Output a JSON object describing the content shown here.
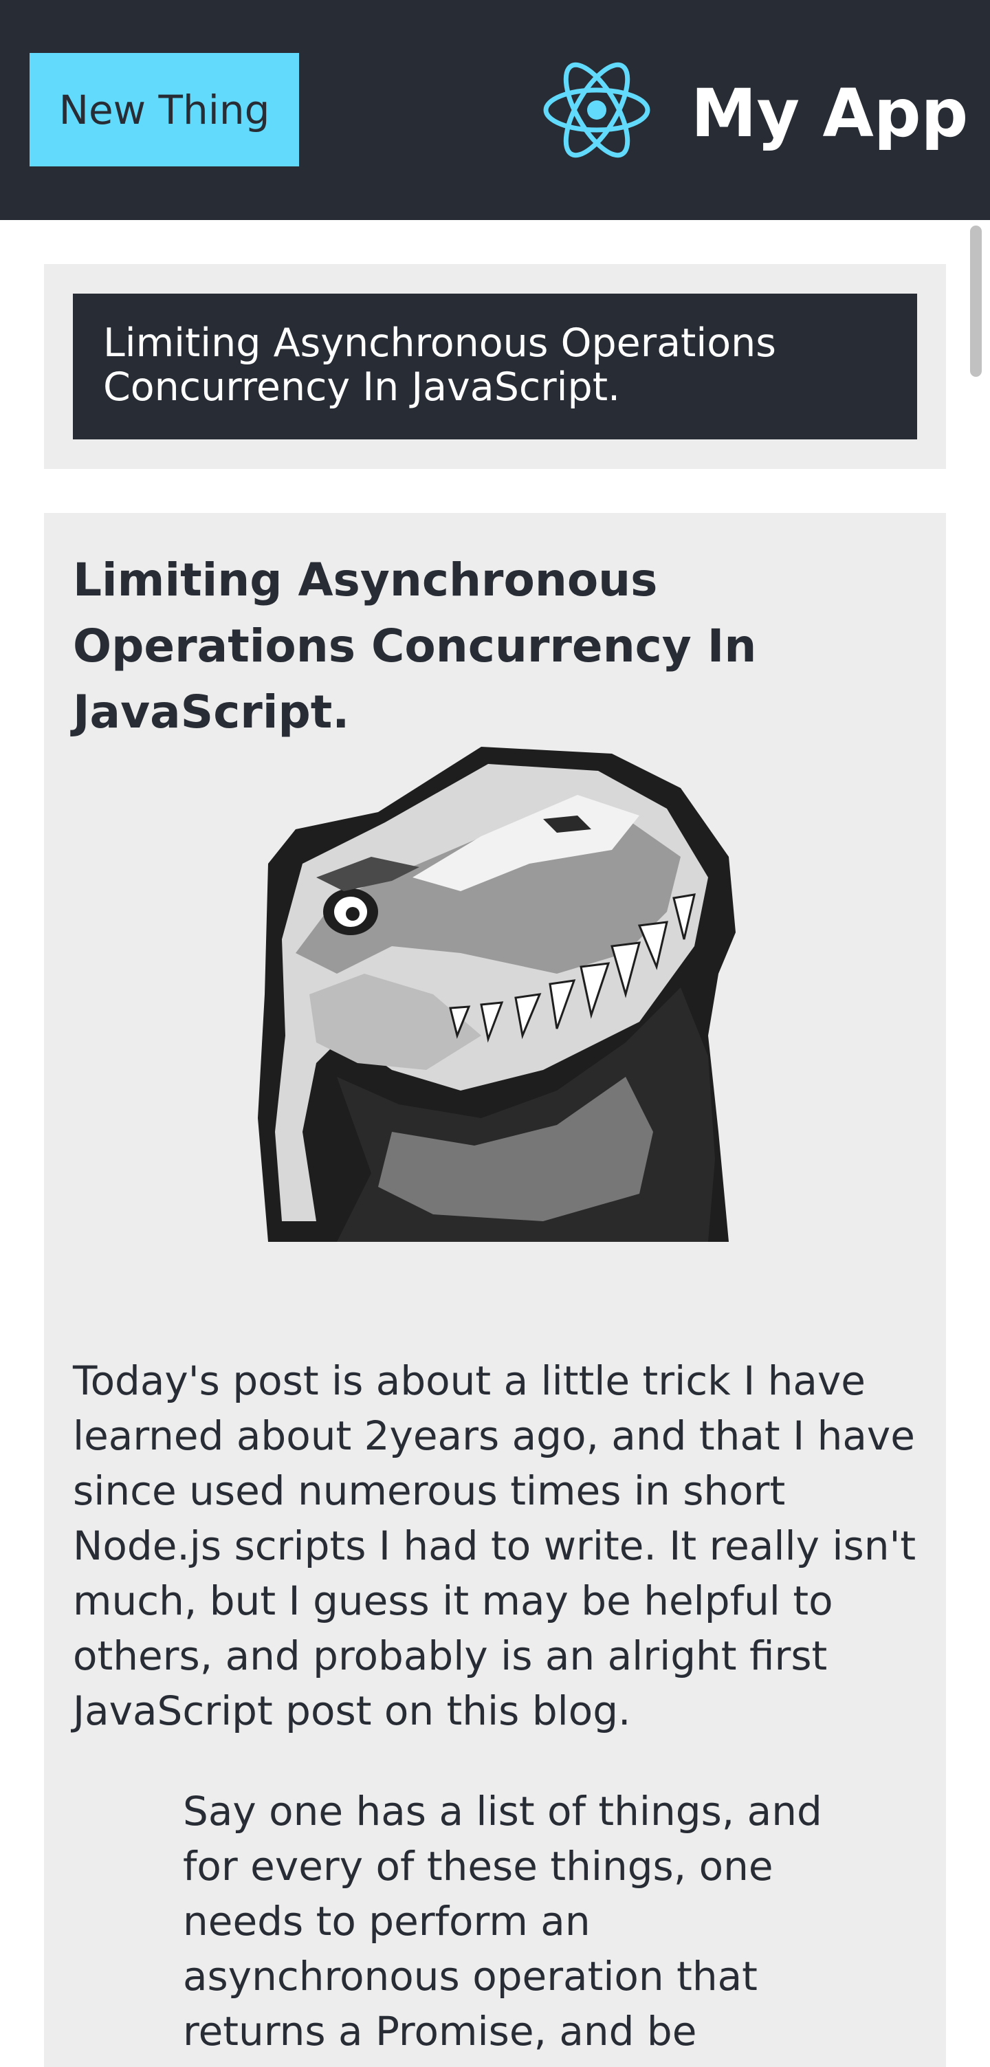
{
  "header": {
    "new_thing_label": "New Thing",
    "logo_icon": "react-atom-icon",
    "app_title": "My App",
    "background_color": "#282c34",
    "accent_color": "#61dafb"
  },
  "post_list": {
    "items": [
      {
        "title": "Limiting Asynchronous Operations Concurrency In JavaScript."
      }
    ]
  },
  "post": {
    "title": "Limiting Asynchronous Operations Concurrency In JavaScript.",
    "image_icon": "t-rex-illustration",
    "paragraph": "Today's post is about a little trick I have learned about 2years ago, and that I have since used numerous times in short Node.js scripts I had to write. It really isn't much, but I guess it may be helpful to others, and probably is an alright first JavaScript post on this blog.",
    "blockquote": "Say one has a list of things, and for every of these things, one needs to perform an asynchronous operation that returns a Promise, and be"
  }
}
